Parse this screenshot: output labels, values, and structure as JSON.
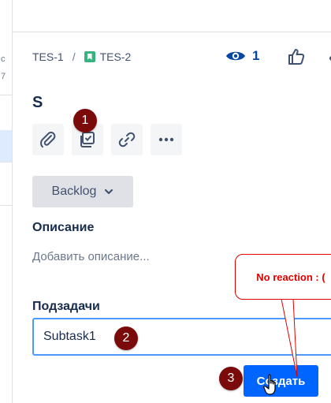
{
  "sidebar": {
    "fragments": [
      "c",
      "7"
    ]
  },
  "breadcrumb": {
    "parent_key": "TES-1",
    "separator": "/",
    "issue_key": "TES-2"
  },
  "header": {
    "watch_count": "1"
  },
  "issue": {
    "title": "S"
  },
  "status": {
    "label": "Backlog"
  },
  "description": {
    "heading": "Описание",
    "placeholder": "Добавить описание..."
  },
  "subtasks": {
    "heading": "Подзадачи",
    "input_value": "Subtask1",
    "create_label": "Создать"
  },
  "annotations": {
    "marker_1": "1",
    "marker_2": "2",
    "marker_3": "3",
    "callout_text": "No reaction : ("
  },
  "colors": {
    "primary": "#0065ff",
    "marker": "#7b0a0a",
    "callout": "#e00000",
    "story": "#36b37e"
  }
}
